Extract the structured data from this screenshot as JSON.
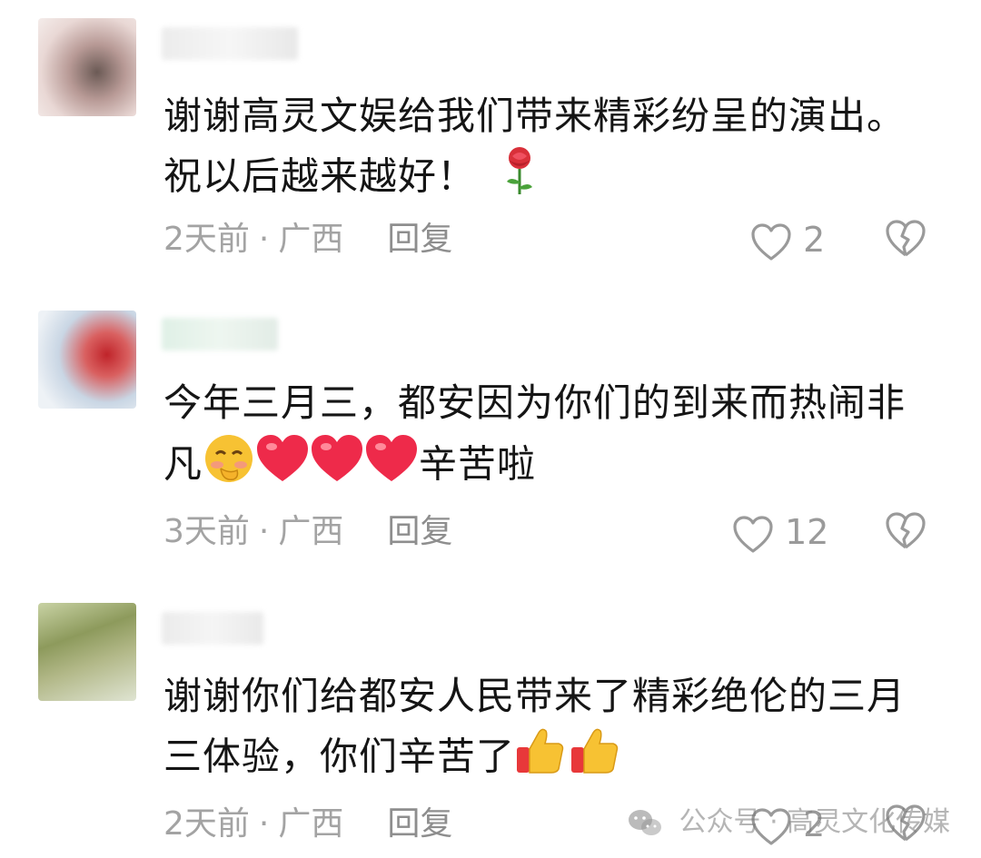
{
  "comments": [
    {
      "text_line1": "谢谢高灵文娱给我们带来精彩纷呈的演出。",
      "text_line2": "祝以后越来越好！",
      "time": "2天前",
      "dot": "·",
      "region": "广西",
      "reply": "回复",
      "likes": "2",
      "emojis": [
        "rose"
      ]
    },
    {
      "text_line1": "今年三月三，都安因为你们的到来而热闹非",
      "text_line2_pre": "凡",
      "text_line2_post": "辛苦啦",
      "time": "3天前",
      "dot": "·",
      "region": "广西",
      "reply": "回复",
      "likes": "12",
      "emojis": [
        "blushing-face",
        "red-heart",
        "red-heart",
        "red-heart"
      ]
    },
    {
      "text_line1": "谢谢你们给都安人民带来了精彩绝伦的三月",
      "text_line2": "三体验，你们辛苦了",
      "time": "2天前",
      "dot": "·",
      "region": "广西",
      "reply": "回复",
      "likes": "2",
      "emojis": [
        "thumbs-up",
        "thumbs-up"
      ]
    }
  ],
  "watermark": {
    "text": "公众号 · 高灵文化传媒"
  },
  "colors": {
    "text": "#151515",
    "meta": "#a3a3a3",
    "icon": "#9a9a9a"
  }
}
